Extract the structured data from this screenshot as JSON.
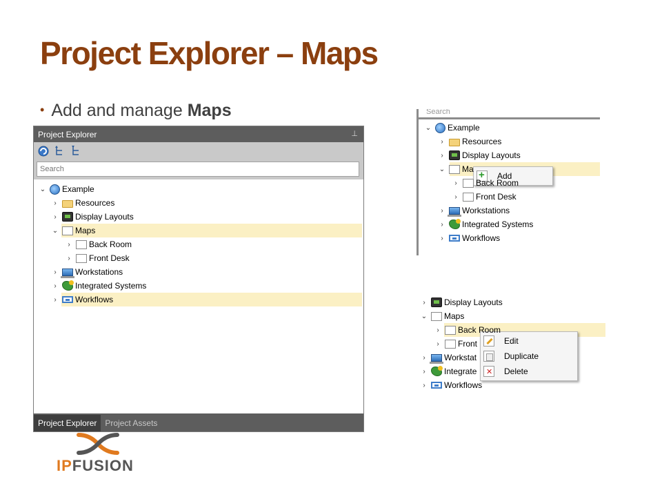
{
  "slide": {
    "title": "Project Explorer – Maps",
    "bullet_prefix": "Add and manage ",
    "bullet_bold": "Maps"
  },
  "panel": {
    "header_title": "Project Explorer",
    "pin_icon": "pin-icon",
    "search_placeholder": "Search",
    "tree": [
      {
        "label": "Example",
        "icon": "globe-icon",
        "chevron": "expanded",
        "depth": 0
      },
      {
        "label": "Resources",
        "icon": "folder-icon",
        "chevron": "collapsed",
        "depth": 1
      },
      {
        "label": "Display Layouts",
        "icon": "display-icon",
        "chevron": "collapsed",
        "depth": 1
      },
      {
        "label": "Maps",
        "icon": "map-icon",
        "chevron": "expanded",
        "depth": 1,
        "selected": true
      },
      {
        "label": "Back Room",
        "icon": "map-icon",
        "chevron": "collapsed",
        "depth": 2
      },
      {
        "label": "Front Desk",
        "icon": "map-icon",
        "chevron": "collapsed",
        "depth": 2
      },
      {
        "label": "Workstations",
        "icon": "workstation-icon",
        "chevron": "collapsed",
        "depth": 1
      },
      {
        "label": "Integrated Systems",
        "icon": "integrated-systems-icon",
        "chevron": "collapsed",
        "depth": 1
      },
      {
        "label": "Workflows",
        "icon": "workflow-icon",
        "chevron": "collapsed",
        "depth": 1,
        "highlighted": true
      }
    ],
    "tabs": [
      "Project Explorer",
      "Project Assets"
    ],
    "active_tab": "Project Explorer"
  },
  "snippet_add": {
    "search_placeholder": "Search",
    "tree": {
      "example": "Example",
      "resources": "Resources",
      "display_layouts": "Display Layouts",
      "maps": "Ma",
      "back_room": "Back Room",
      "front_desk": "Front Desk",
      "workstations": "Workstations",
      "integrated_systems": "Integrated Systems",
      "workflows": "Workflows"
    },
    "context_menu": [
      "Add"
    ]
  },
  "snippet_edit": {
    "tree": {
      "display_layouts": "Display Layouts",
      "maps": "Maps",
      "back_room": "Back Room",
      "front": "Front",
      "workstations": "Workstat",
      "integrated": "Integrate",
      "workflows": "Workflows"
    },
    "context_menu": [
      "Edit",
      "Duplicate",
      "Delete"
    ]
  },
  "logo": {
    "part1": "IP",
    "part2": "FUSION"
  },
  "colors": {
    "title": "#8b3f0f",
    "selection": "#fbf0c4",
    "panel_dark": "#5d5d5d",
    "logo_orange": "#e07a1f"
  }
}
